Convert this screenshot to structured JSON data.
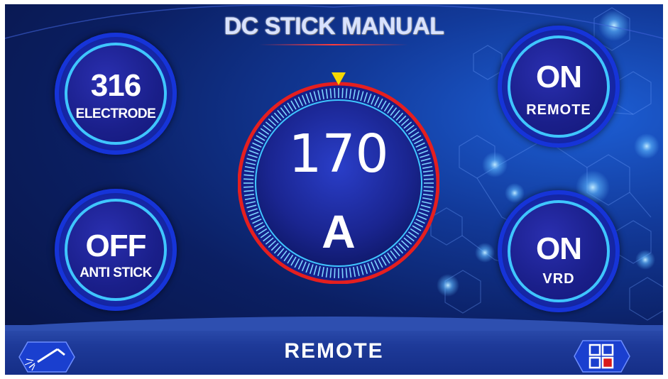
{
  "title": "DC STICK MANUAL",
  "electrode": {
    "value": "316",
    "label": "ELECTRODE"
  },
  "anti_stick": {
    "value": "OFF",
    "label": "ANTI STICK"
  },
  "remote": {
    "value": "ON",
    "label": "REMOTE"
  },
  "vrd": {
    "value": "ON",
    "label": "VRD"
  },
  "dial": {
    "value": "170",
    "unit": "A"
  },
  "footer": {
    "label": "REMOTE"
  },
  "icons": {
    "left": "welding-torch-icon",
    "right": "menu-grid-icon"
  },
  "colors": {
    "accent": "#3fc6ff",
    "ring": "#e01b1b",
    "marker": "#f5d800"
  }
}
